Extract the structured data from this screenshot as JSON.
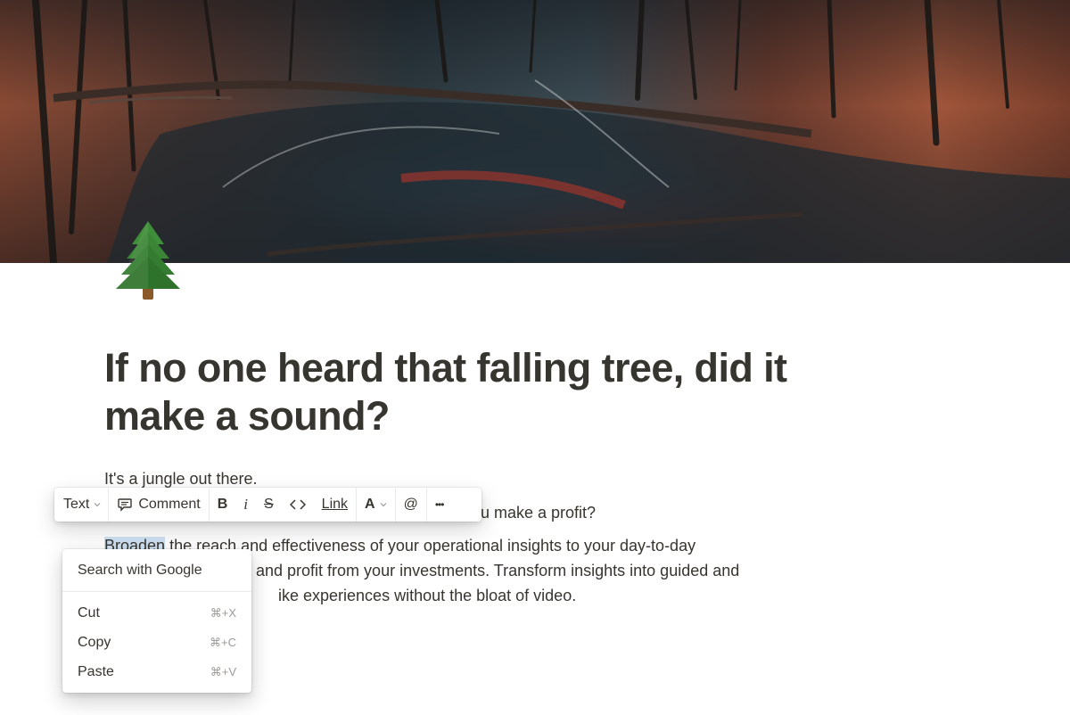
{
  "page": {
    "title": "If no one heard that falling tree, did it make a sound?",
    "icon": "evergreen-tree-emoji",
    "paragraphs": {
      "p1": "It's a jungle out there.",
      "p2_visible": "u make a profit?",
      "p3_selected": "Broaden",
      "p3_line1_rest": " the reach and effectiveness of your operational insights to your day-to-day",
      "p3_line2_visible": "and profit from your investments. Transform insights into guided and",
      "p3_line3_visible": "ike experiences without the bloat of video."
    }
  },
  "toolbar": {
    "text_label": "Text",
    "comment_label": "Comment",
    "bold_label": "B",
    "italic_label": "i",
    "strike_label": "S",
    "code_label": "<>",
    "link_label": "Link",
    "color_label": "A",
    "mention_label": "@",
    "more_label": "•••"
  },
  "context_menu": {
    "search_label": "Search with Google",
    "items": [
      {
        "label": "Cut",
        "shortcut": "⌘+X"
      },
      {
        "label": "Copy",
        "shortcut": "⌘+C"
      },
      {
        "label": "Paste",
        "shortcut": "⌘+V"
      }
    ]
  },
  "colors": {
    "text": "#37352f",
    "selection": "#cfe2f3",
    "muted": "#9b9a97"
  }
}
